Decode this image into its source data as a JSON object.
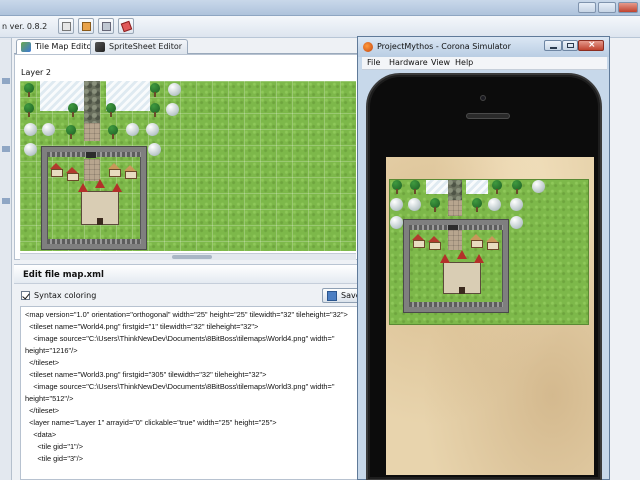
{
  "editor": {
    "version_label": "n ver. 0.8.2",
    "tabs": [
      {
        "label": "Tile Map Editor",
        "active": true
      },
      {
        "label": "SpriteSheet Editor",
        "active": false
      }
    ],
    "layer_label": "Layer 2",
    "file_panel_title": "Edit file map.xml",
    "syntax_coloring_label": "Syntax coloring",
    "syntax_coloring_checked": true,
    "save_label": "Save",
    "code_lines": [
      "<map version=\"1.0\" orientation=\"orthogonal\" width=\"25\" height=\"25\" tilewidth=\"32\" tileheight=\"32\">",
      "  <tileset name=\"World4.png\" firstgid=\"1\" tilewidth=\"32\" tileheight=\"32\">",
      "    <image source=\"C:\\Users\\ThinkNewDev\\Documents\\8BitBoss\\tilemaps\\World4.png\" width=\"",
      "height=\"1216\"/>",
      "  </tileset>",
      "  <tileset name=\"World3.png\" firstgid=\"305\" tilewidth=\"32\" tileheight=\"32\">",
      "    <image source=\"C:\\Users\\ThinkNewDev\\Documents\\8BitBoss\\tilemaps\\World3.png\" width=\"",
      "height=\"512\"/>",
      "  </tileset>",
      "  <layer name=\"Layer 1\" arrayid=\"0\" clickable=\"true\" width=\"25\" height=\"25\">",
      "    <data>",
      "      <tile gid=\"1\"/>",
      "      <tile gid=\"3\"/>"
    ]
  },
  "simulator": {
    "title": "ProjectMythos - Corona Simulator",
    "menu": [
      "File",
      "Hardware",
      "View",
      "Help"
    ]
  },
  "colors": {
    "grass": "#7db84a",
    "parchment": "#e8d4ad",
    "window_chrome": "#c7d8ea"
  },
  "icons": [
    "tile-map-icon",
    "spritesheet-icon",
    "save-icon",
    "corona-app-icon",
    "minimize-icon",
    "maximize-icon",
    "close-icon"
  ]
}
